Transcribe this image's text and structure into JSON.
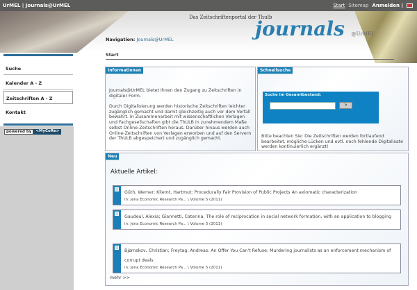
{
  "topbar": {
    "title": "UrMEL | Journals@UrMEL",
    "start": "Start",
    "sitemap": "Sitemap",
    "login": "Anmelden |"
  },
  "header": {
    "subtitle": "Das Zeitschriftenportal der Thulb",
    "logo": "journals",
    "logo_at": "@",
    "logo_sub": "UrMEL"
  },
  "sidebar": {
    "items": [
      {
        "label": "Suche"
      },
      {
        "label": "Kalender A - Z"
      },
      {
        "label": "Zeitschriften A - Z"
      },
      {
        "label": "Kontakt"
      }
    ],
    "powered_a": "powered by",
    "powered_b": "<MyCoRe>"
  },
  "nav": {
    "label": "Navigation:",
    "value": "Journals@UrMEL"
  },
  "page_title": "Start",
  "info": {
    "title": "Informationen",
    "p1": "Journals@UrMEL bietet Ihnen den Zugang zu Zeitschriften in digitaler Form.",
    "p2": "Durch Digitalisierung werden historische Zeitschriften leichter zugänglich gemacht und damit gleichzeitig auch vor dem Verfall bewahrt. In Zusammenarbeit mit wissenschaftlichen Verlagen und Fachgesellschaften gibt die ThULB in zunehmendem Maße selbst Online-Zeitschriften heraus. Darüber hinaus werden auch Online-Zeitschriften von Verlagen erworben und auf den Servern der ThULB abgespeichert und zugänglich gemacht."
  },
  "search": {
    "title": "Schnellsuche",
    "label": "Suche im Gesamtbestand:",
    "value": "",
    "button": ">",
    "note": "Bitte beachten Sie: Die Zeitschriften werden fortlaufend bearbeitet, mögliche Lücken und evtl. noch fehlende Digitalisate werden kontinuierlich ergänzt!"
  },
  "neu": {
    "title": "Neu",
    "heading": "Aktuelle Artikel:",
    "articles": [
      {
        "title": "Güth, Werner; Kliemt, Hartmut: Procedurally Fair Provision of Public Projects An axiomatic characterization",
        "source": "in: Jena Economic Research Pa... \\ Volume 5 (2011)"
      },
      {
        "title": "Gaudeul, Alexia; Giannetti, Caterina: The role of reciprocation in social network formation, with an application to blogging",
        "source": "in: Jena Economic Research Pa... \\ Volume 5 (2011)"
      },
      {
        "title": "Bjørnskov, Christian; Freytag, Andreas: An Offer You Can't Refuse: Murdering journalists as an enforcement mechanism of corrupt deals",
        "source": "in: Jena Economic Research Pa... \\ Volume 5 (2011)"
      }
    ],
    "more": "mehr >>"
  }
}
